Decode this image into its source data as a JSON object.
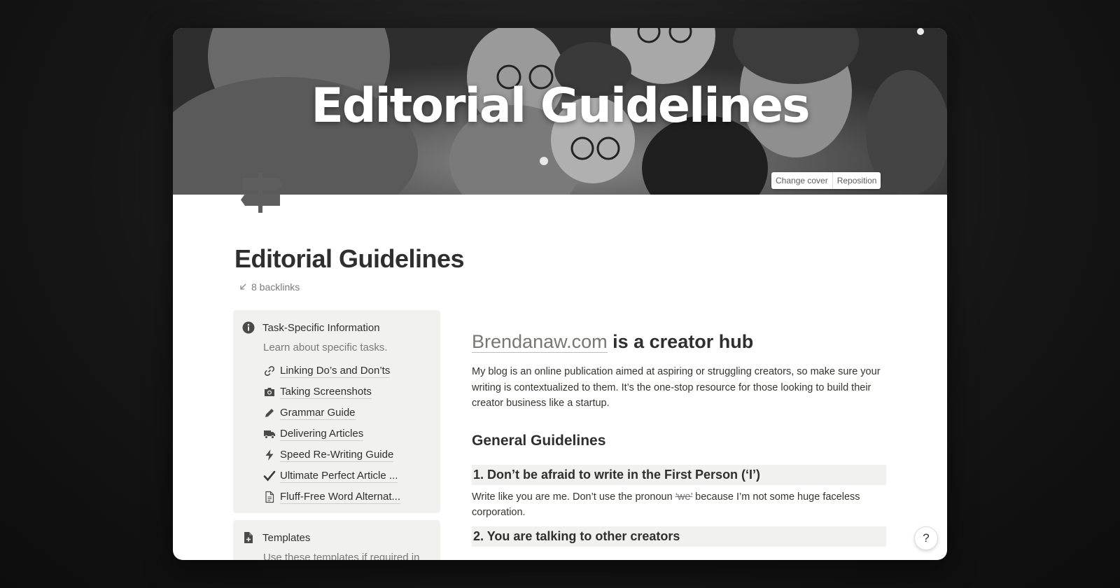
{
  "cover": {
    "title": "Editorial Guidelines",
    "change_cover_label": "Change cover",
    "reposition_label": "Reposition"
  },
  "page": {
    "title": "Editorial Guidelines",
    "backlinks": "8 backlinks"
  },
  "callouts": [
    {
      "title": "Task-Specific Information",
      "description": "Learn about specific tasks.",
      "links": [
        {
          "label": "Linking Do’s and Don’ts",
          "icon": "link-icon"
        },
        {
          "label": "Taking Screenshots",
          "icon": "camera-icon"
        },
        {
          "label": "Grammar Guide",
          "icon": "pencil-icon"
        },
        {
          "label": "Delivering Articles",
          "icon": "truck-icon"
        },
        {
          "label": "Speed Re-Writing Guide",
          "icon": "lightning-icon"
        },
        {
          "label": "Ultimate Perfect Article ...",
          "icon": "checkmark-icon"
        },
        {
          "label": "Fluff-Free Word Alternat...",
          "icon": "document-icon"
        }
      ]
    },
    {
      "title": "Templates",
      "description": "Use these templates if required in"
    }
  ],
  "content": {
    "heading_link": "Brendanaw.com",
    "heading_rest": " is a creator hub",
    "intro": "My blog is an online publication aimed at aspiring or struggling creators, so make sure your writing is contextualized to them. It’s the one-stop resource for those looking to build their creator business like a startup.",
    "general_heading": "General Guidelines",
    "rule1_heading": "1. Don’t be afraid to write in the First Person (‘I’)",
    "rule1_pre": "Write like you are me. Don’t use the pronoun ",
    "rule1_strike": "‘we’",
    "rule1_post": " because I’m not some huge faceless corporation.",
    "rule2_heading": "2. You are talking to other creators"
  },
  "help_label": "?"
}
